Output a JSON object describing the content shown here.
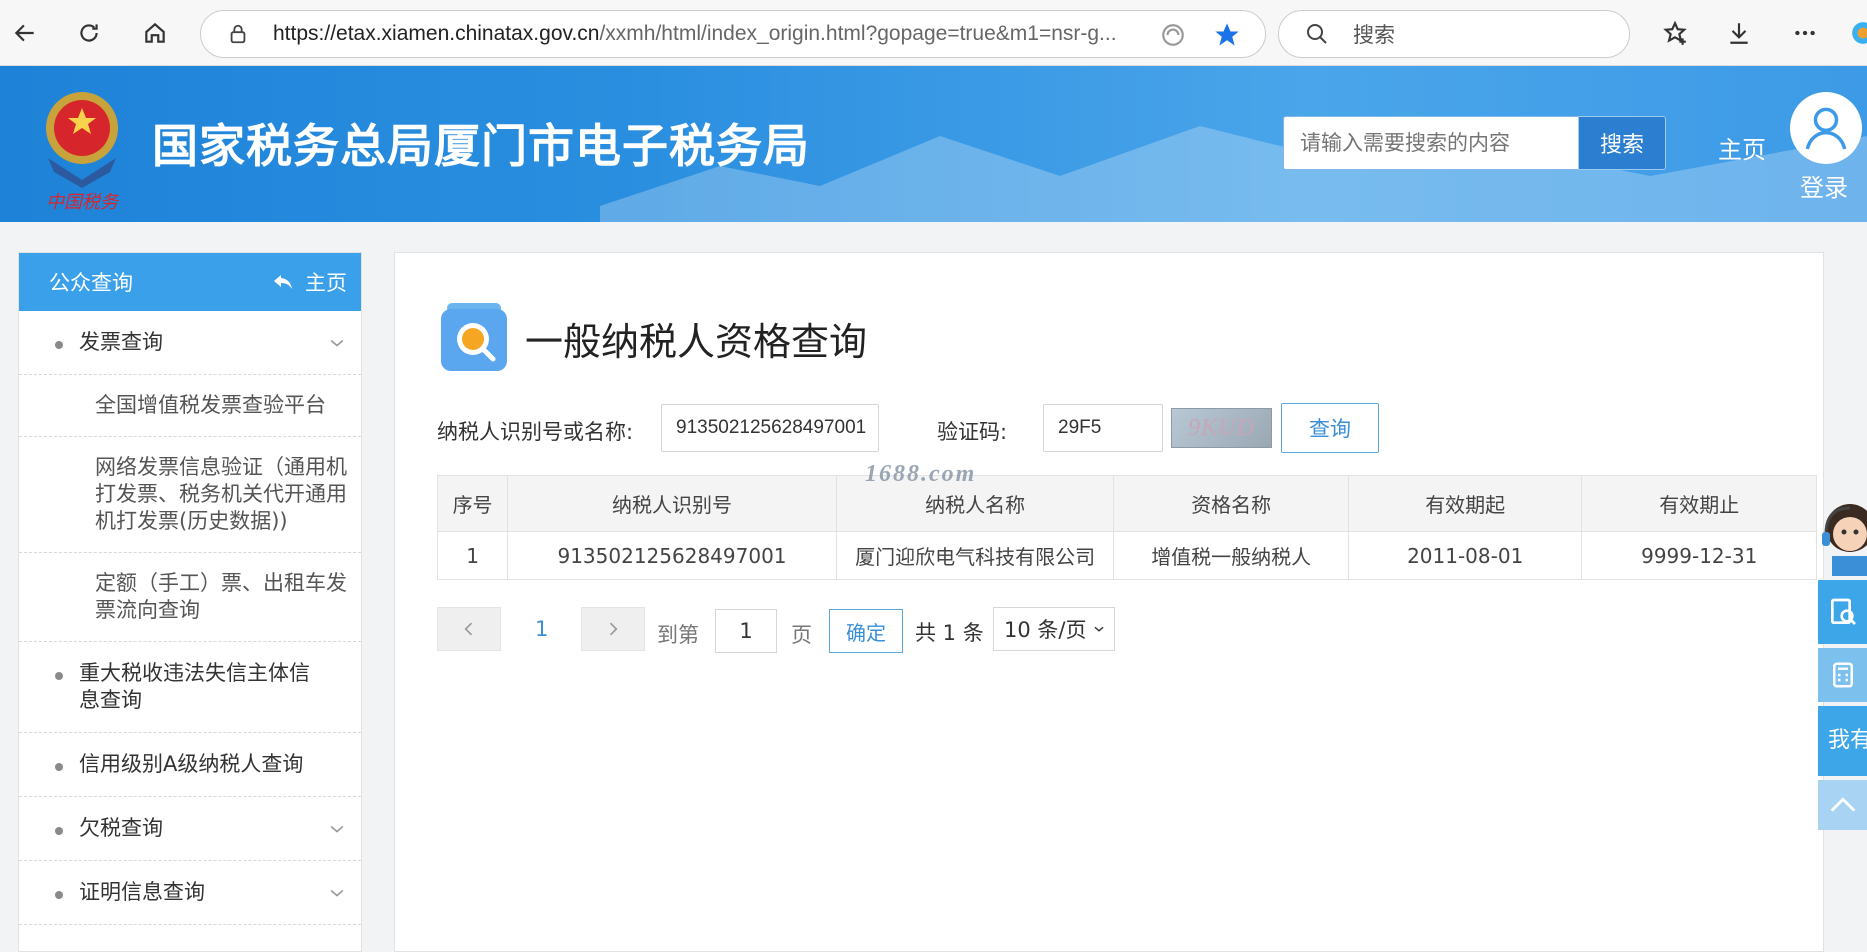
{
  "browser": {
    "url_host": "https://etax.xiamen.chinatax.gov.cn",
    "url_path": "/xxmh/html/index_origin.html?gopage=true&m1=nsr-g...",
    "search_placeholder": "搜索"
  },
  "header": {
    "emblem_signature": "中国税务",
    "site_title": "国家税务总局厦门市电子税务局",
    "search_placeholder": "请输入需要搜索的内容",
    "search_button": "搜索",
    "home_link": "主页",
    "login_link": "登录"
  },
  "sidebar": {
    "title": "公众查询",
    "home_label": "主页",
    "items": [
      {
        "label": "发票查询",
        "has_chevron": true
      },
      {
        "label": "全国增值税发票查验平台",
        "sub": true
      },
      {
        "label": "网络发票信息验证（通用机打发票、税务机关代开通用机打发票(历史数据))",
        "sub": true
      },
      {
        "label": "定额（手工）票、出租车发票流向查询",
        "sub": true
      },
      {
        "label": "重大税收违法失信主体信息查询",
        "has_chevron": false
      },
      {
        "label": "信用级别A级纳税人查询",
        "has_chevron": false
      },
      {
        "label": "欠税查询",
        "has_chevron": true
      },
      {
        "label": "证明信息查询",
        "has_chevron": true
      }
    ]
  },
  "main": {
    "page_title": "一般纳税人资格查询",
    "form": {
      "taxpayer_label": "纳税人识别号或名称:",
      "taxpayer_value": "913502125628497001",
      "captcha_label": "验证码:",
      "captcha_value": "29F5",
      "captcha_image_text": "9KUD",
      "query_button": "查询"
    },
    "watermark": "1688.com",
    "table": {
      "columns": [
        "序号",
        "纳税人识别号",
        "纳税人名称",
        "资格名称",
        "有效期起",
        "有效期止"
      ],
      "rows": [
        [
          "1",
          "913502125628497001",
          "厦门迎欣电气科技有限公司",
          "增值税一般纳税人",
          "2011-08-01",
          "9999-12-31"
        ]
      ]
    },
    "pager": {
      "current_page": "1",
      "goto_prefix": "到第",
      "goto_value": "1",
      "goto_suffix": "页",
      "confirm": "确定",
      "total": "共 1 条",
      "page_size": "10 条/页"
    }
  },
  "float_tools": {
    "suggest_label": "我有建议"
  },
  "colors": {
    "header_blue": "#2b8fe0",
    "sidebar_head": "#3ba0ea",
    "link_blue": "#3a8fd6"
  }
}
